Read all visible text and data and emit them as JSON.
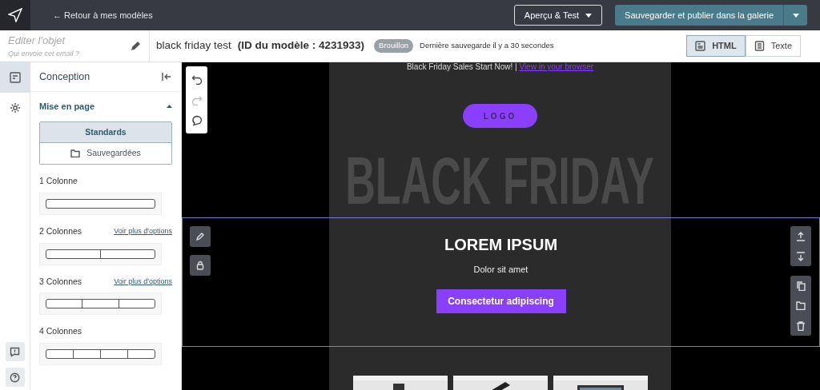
{
  "header": {
    "back_link": "← Retour à mes modèles",
    "preview_button": "Aperçu & Test",
    "publish_button": "Sauvegarder et publier dans la galerie"
  },
  "subject": {
    "placeholder": "Editer l'objet",
    "hint": "Qui envoie cet email ?"
  },
  "template": {
    "name": "black friday test",
    "id_label": "(ID du modèle : 4231933)",
    "status": "Brouillon",
    "saved": "Dernière sauvegarde il y a 30 secondes"
  },
  "view_toggle": [
    {
      "label": "HTML",
      "kind": "html",
      "selected": true
    },
    {
      "label": "Texte",
      "kind": "text",
      "selected": false
    }
  ],
  "rail": [
    {
      "kind": "design",
      "selected": true
    },
    {
      "kind": "settings",
      "selected": false
    }
  ],
  "sidebar": {
    "title": "Conception",
    "section": {
      "title": "Mise en page",
      "expanded": true
    },
    "tabs": [
      {
        "label": "Standards",
        "selected": true
      },
      {
        "label": "Sauvegardées",
        "selected": false
      }
    ],
    "layouts": [
      {
        "label": "1 Colonne",
        "kind": "single"
      },
      {
        "label": "2 Colonnes",
        "kind": "double",
        "link": "Voir plus d'options"
      },
      {
        "label": "3 Colonnes",
        "kind": "triple",
        "link": "Voir plus d'options"
      },
      {
        "label": "4 Colonnes",
        "kind": "quad"
      }
    ]
  },
  "canvas": {
    "toolbar": [
      {
        "kind": "undo",
        "disabled": false
      },
      {
        "kind": "redo",
        "disabled": true
      },
      {
        "kind": "comment",
        "disabled": false
      }
    ],
    "preheader": {
      "text": "Black Friday Sales Start Now! |",
      "link": "View in your browser"
    },
    "logo": "LOGO",
    "hero": "BLACK FRIDAY",
    "block": {
      "title": "LOREM IPSUM",
      "text": "Dolor sit amet",
      "button": "Consectetur adipiscing"
    }
  }
}
